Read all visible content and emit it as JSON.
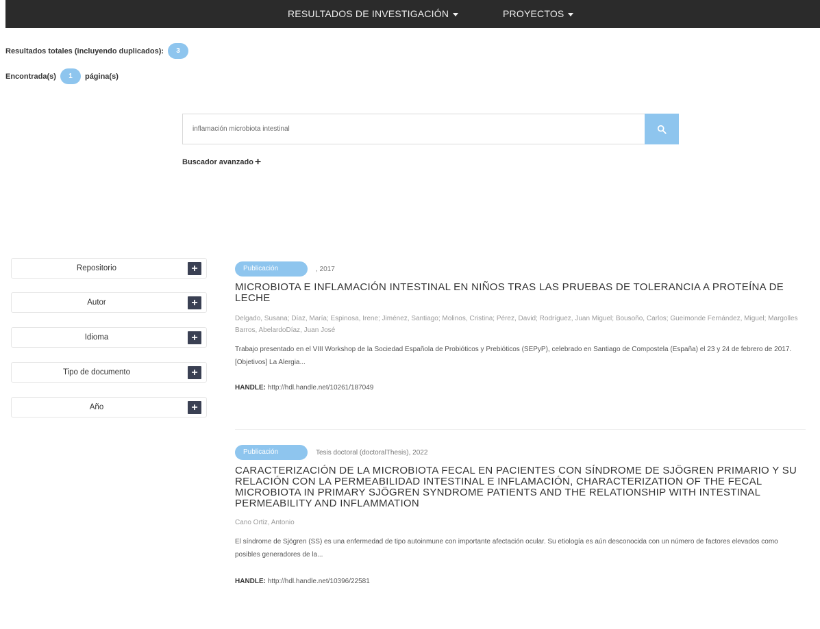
{
  "nav": {
    "items": [
      {
        "label": "RESULTADOS DE INVESTIGACIÓN"
      },
      {
        "label": "PROYECTOS"
      }
    ]
  },
  "stats": {
    "total_label": "Resultados totales (incluyendo duplicados):",
    "total_count": "3",
    "found_label": "Encontrada(s)",
    "found_pages": "1",
    "pages_label": "página(s)"
  },
  "search": {
    "value": "inflamación microbiota intestinal",
    "advanced_label": "Buscador avanzado"
  },
  "facets": [
    {
      "label": "Repositorio"
    },
    {
      "label": "Autor"
    },
    {
      "label": "Idioma"
    },
    {
      "label": "Tipo de documento"
    },
    {
      "label": "Año"
    }
  ],
  "results": [
    {
      "badge": "Publicación",
      "meta": ", 2017",
      "title": "MICROBIOTA E INFLAMACIÓN INTESTINAL EN NIÑOS TRAS LAS PRUEBAS DE TOLERANCIA A PROTEÍNA DE LECHE",
      "authors": "Delgado, Susana; Díaz, María; Espinosa, Irene; Jiménez, Santiago; Molinos, Cristina; Pérez, David; Rodríguez, Juan Miguel; Bousoño, Carlos; Gueimonde Fernández, Miguel; Margolles Barros, AbelardoDíaz, Juan José",
      "abstract": "Trabajo presentado en el VIII Workshop de la Sociedad Española de Probióticos y Prebióticos (SEPyP), celebrado en Santiago de Compostela (España) el 23 y 24 de febrero de 2017. [Objetivos] La Alergia...",
      "handle_label": "HANDLE:",
      "handle_url": "http://hdl.handle.net/10261/187049"
    },
    {
      "badge": "Publicación",
      "meta": "Tesis doctoral (doctoralThesis), 2022",
      "title": "CARACTERIZACIÓN DE LA MICROBIOTA FECAL EN PACIENTES CON SÍNDROME DE SJÖGREN PRIMARIO Y SU RELACIÓN CON LA PERMEABILIDAD INTESTINAL E INFLAMACIÓN, CHARACTERIZATION OF THE FECAL MICROBIOTA IN PRIMARY SJÖGREN SYNDROME PATIENTS AND THE RELATIONSHIP WITH INTESTINAL PERMEABILITY AND INFLAMMATION",
      "authors": "Cano Ortiz, Antonio",
      "abstract": "El síndrome de Sjögren (SS) es una enfermedad de tipo autoinmune con importante afectación ocular. Su etiología es aún desconocida con un número de factores elevados como posibles generadores de la...",
      "handle_label": "HANDLE:",
      "handle_url": "http://hdl.handle.net/10396/22581"
    }
  ],
  "colors": {
    "accent": "#8ec5ee",
    "nav_bg": "#2b2b2b",
    "facet_button": "#3a4053"
  }
}
